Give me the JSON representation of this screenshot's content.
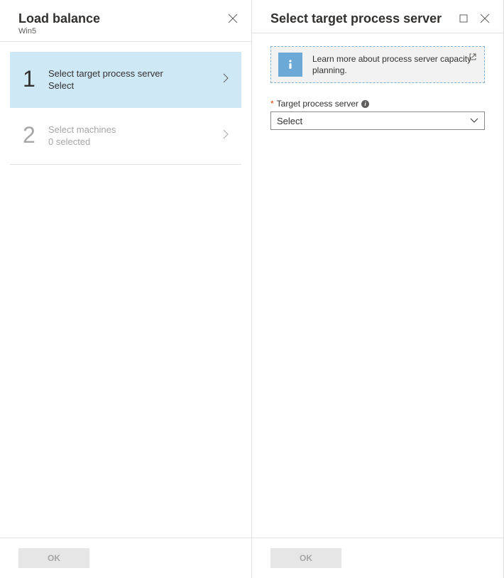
{
  "left": {
    "title": "Load balance",
    "subtitle": "Win5",
    "steps": [
      {
        "num": "1",
        "title": "Select target process server",
        "sub": "Select",
        "active": true
      },
      {
        "num": "2",
        "title": "Select machines",
        "sub": "0 selected",
        "active": false
      }
    ],
    "ok_label": "OK"
  },
  "right": {
    "title": "Select target process server",
    "info_text": "Learn more about process server capacity planning.",
    "field": {
      "label": "Target process server",
      "value": "Select"
    },
    "ok_label": "OK"
  }
}
